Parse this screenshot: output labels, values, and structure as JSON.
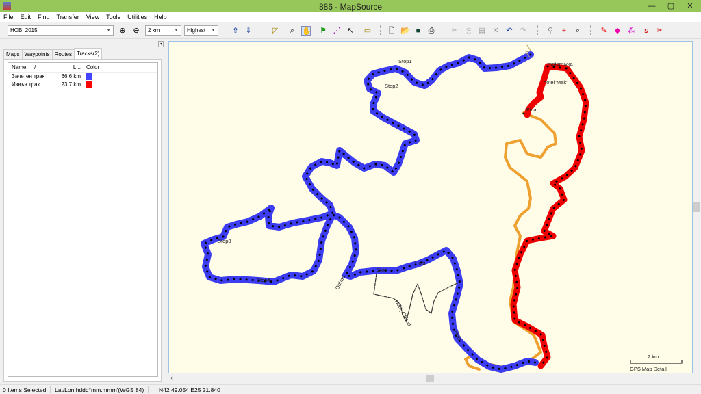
{
  "window": {
    "title": "886 - MapSource",
    "minimize": "—",
    "maximize": "▢",
    "close": "✕"
  },
  "menu": [
    "File",
    "Edit",
    "Find",
    "Transfer",
    "View",
    "Tools",
    "Utilities",
    "Help"
  ],
  "toolbar": {
    "map_product": "HOBI 2015",
    "zoom_scale": "2 km",
    "detail": "Highest"
  },
  "panel": {
    "tabs": [
      "Maps",
      "Waypoints",
      "Routes",
      "Tracks(2)"
    ],
    "active_tab": "Tracks(2)",
    "collapse": "◂",
    "columns": [
      "Name",
      "/",
      "L...",
      "Color"
    ],
    "tracks": [
      {
        "name": "Зачетен трак",
        "length": "66.6 km",
        "color": "#4444ff"
      },
      {
        "name": "Извън трак",
        "length": "23.7 km",
        "color": "#ff0000"
      }
    ]
  },
  "map": {
    "labels": {
      "stop1": "Stop1",
      "stop2": "Stop2",
      "stop3": "Stop3",
      "stop4": "Stop4",
      "stop": "Stop",
      "hobi1": "Hobi",
      "hobi2": "Hobi",
      "obhod": "Obhod",
      "hobi_obhod": "Hobi_Obhod",
      "motornivka": "motornivka",
      "hotel": "hotel\"Mak\"",
      "final": "Final"
    },
    "scale_label": "2 km",
    "detail_label": "GPS Map Detail",
    "colors": {
      "track_blue": "#3c3cf0",
      "track_red": "#ee0000",
      "track_orange": "#eea030",
      "background": "#fffde8"
    }
  },
  "status": {
    "selection": "0 Items Selected",
    "format": "Lat/Lon hddd°mm.mmm'(WGS 84)",
    "position": "N42 49.054 E25 21.840"
  }
}
